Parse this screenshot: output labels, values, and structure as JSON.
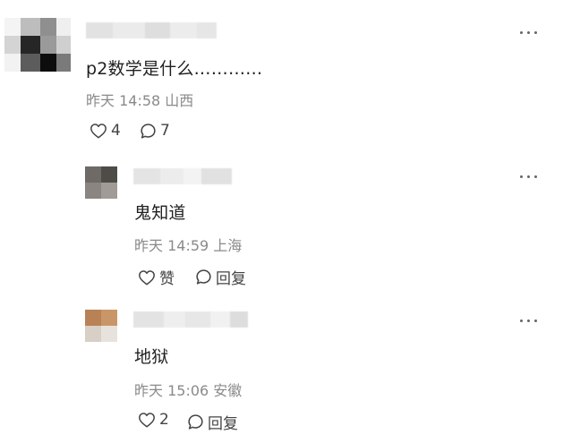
{
  "comments": [
    {
      "content": "p2数学是什么…………",
      "time": "昨天 14:58",
      "location": "山西",
      "likes": "4",
      "replies": "7",
      "more_icon": "more-horizontal-icon"
    },
    {
      "content": "鬼知道",
      "time": "昨天 14:59",
      "location": "上海",
      "like_label": "赞",
      "reply_label": "回复"
    },
    {
      "content": "地狱",
      "time": "昨天 15:06",
      "location": "安徽",
      "likes": "2",
      "reply_label": "回复"
    }
  ],
  "colors": {
    "text": "#1f1f1f",
    "meta": "#8a8a8a",
    "icon": "#444444",
    "background": "#ffffff"
  }
}
